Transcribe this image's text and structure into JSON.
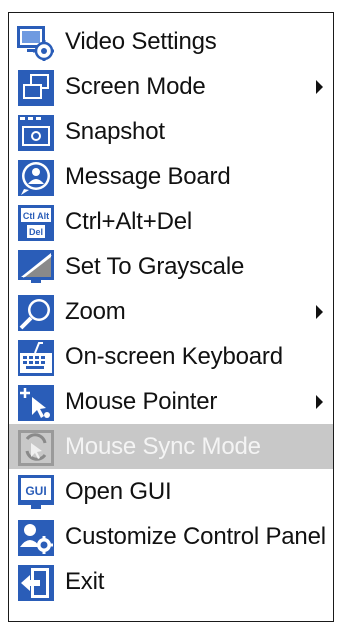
{
  "menu": {
    "items": [
      {
        "label": "Video Settings",
        "icon": "video-settings-icon",
        "submenu": false,
        "disabled": false
      },
      {
        "label": "Screen Mode",
        "icon": "screen-mode-icon",
        "submenu": true,
        "disabled": false
      },
      {
        "label": "Snapshot",
        "icon": "snapshot-icon",
        "submenu": false,
        "disabled": false
      },
      {
        "label": "Message Board",
        "icon": "message-board-icon",
        "submenu": false,
        "disabled": false
      },
      {
        "label": "Ctrl+Alt+Del",
        "icon": "ctrl-alt-del-icon",
        "submenu": false,
        "disabled": false
      },
      {
        "label": "Set To Grayscale",
        "icon": "grayscale-icon",
        "submenu": false,
        "disabled": false
      },
      {
        "label": "Zoom",
        "icon": "zoom-icon",
        "submenu": true,
        "disabled": false
      },
      {
        "label": "On-screen Keyboard",
        "icon": "keyboard-icon",
        "submenu": false,
        "disabled": false
      },
      {
        "label": "Mouse Pointer",
        "icon": "mouse-pointer-icon",
        "submenu": true,
        "disabled": false
      },
      {
        "label": "Mouse Sync Mode",
        "icon": "mouse-sync-icon",
        "submenu": false,
        "disabled": true
      },
      {
        "label": "Open GUI",
        "icon": "open-gui-icon",
        "submenu": false,
        "disabled": false
      },
      {
        "label": "Customize Control Panel",
        "icon": "customize-panel-icon",
        "submenu": false,
        "disabled": false
      },
      {
        "label": "Exit",
        "icon": "exit-icon",
        "submenu": false,
        "disabled": false
      }
    ]
  },
  "colors": {
    "icon_blue": "#2a5db8",
    "icon_blue_dark": "#153f8f",
    "disabled_row": "#c8c8c8",
    "text": "#111111"
  },
  "icon_labels": {
    "ctrl_alt_del_top": "Ctl Alt",
    "ctrl_alt_del_bottom": "Del",
    "open_gui": "GUI"
  }
}
